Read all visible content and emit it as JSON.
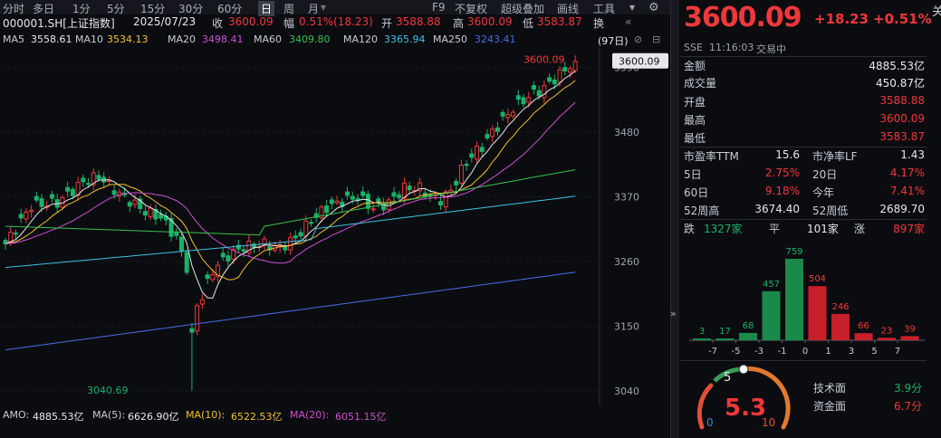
{
  "tabs": {
    "items": [
      "分时",
      "多日",
      "1分",
      "5分",
      "15分",
      "30分",
      "60分",
      "日",
      "周",
      "月"
    ],
    "right": [
      "F9",
      "不复权",
      "超级叠加",
      "画线",
      "工具"
    ]
  },
  "info": {
    "code": "000001.SH[上证指数]",
    "date": "2025/07/23",
    "close_label": "收",
    "close": "3600.09",
    "chg_label": "幅",
    "chg": "0.51%(18.23)",
    "open_label": "开",
    "open": "3588.88",
    "high_label": "高",
    "high": "3600.09",
    "low_label": "低",
    "low": "3583.87",
    "more": "换"
  },
  "ma": [
    {
      "label": "MA5",
      "value": "3558.61",
      "color": "#e8e8e8"
    },
    {
      "label": "MA10",
      "value": "3534.13",
      "color": "#f0c030"
    },
    {
      "label": "MA20",
      "value": "3498.41",
      "color": "#d050d0"
    },
    {
      "label": "MA60",
      "value": "3409.80",
      "color": "#38c050"
    },
    {
      "label": "MA120",
      "value": "3365.94",
      "color": "#40c0e0"
    },
    {
      "label": "MA250",
      "value": "3243.41",
      "color": "#4a6ae8"
    }
  ],
  "days_badge": "(97日)",
  "chart_data": {
    "type": "candlestick",
    "y_ticks": [
      "3590",
      "3480",
      "3370",
      "3260",
      "3150",
      "3040"
    ],
    "ylim": [
      3025,
      3615
    ],
    "current_price": "3600.09",
    "high_label": "3600.09",
    "low_label": "3040.69"
  },
  "bottom": {
    "amo_label": "AMO:",
    "amo": "4885.53亿",
    "ma5_label": "MA(5):",
    "ma5": "6626.90亿",
    "ma10_label": "MA(10):",
    "ma10": "6522.53亿",
    "ma20_label": "MA(20):",
    "ma20": "6051.15亿"
  },
  "right": {
    "price": "3600.09",
    "chg": "+18.23",
    "pct": "+0.51%",
    "exchange": "SSE",
    "time": "11:16:03",
    "status": "交易中",
    "rows": [
      {
        "l": "金额",
        "v": "4885.53亿",
        "c": "white"
      },
      {
        "l": "成交量",
        "v": "450.87亿",
        "c": "white"
      },
      {
        "l": "开盘",
        "v": "3588.88",
        "c": "red"
      },
      {
        "l": "最高",
        "v": "3600.09",
        "c": "red"
      },
      {
        "l": "最低",
        "v": "3583.87",
        "c": "red"
      }
    ],
    "pe_label": "市盈率TTM",
    "pe": "15.6",
    "pb_label": "市净率LF",
    "pb": "1.43",
    "d5_label": "5日",
    "d5": "2.75%",
    "d20_label": "20日",
    "d20": "4.17%",
    "d60_label": "60日",
    "d60": "9.18%",
    "ytd_label": "今年",
    "ytd": "7.41%",
    "w52h_label": "52周高",
    "w52h": "3674.40",
    "w52l_label": "52周低",
    "w52l": "2689.70",
    "down_label": "跌",
    "down": "1327家",
    "flat_label": "平",
    "flat": "101家",
    "up_label": "涨",
    "up": "897家",
    "dist": {
      "labels": [
        "-7",
        "-5",
        "-3",
        "-1",
        "0",
        "1",
        "3",
        "5",
        "7"
      ],
      "values": [
        3,
        17,
        68,
        457,
        759,
        504,
        246,
        66,
        23,
        39
      ]
    },
    "gauge": {
      "score": "5.3",
      "min": "0",
      "mid": "5",
      "max": "10",
      "tech_label": "技术面",
      "tech": "3.9分",
      "fund_label": "资金面",
      "fund": "6.7分"
    }
  }
}
